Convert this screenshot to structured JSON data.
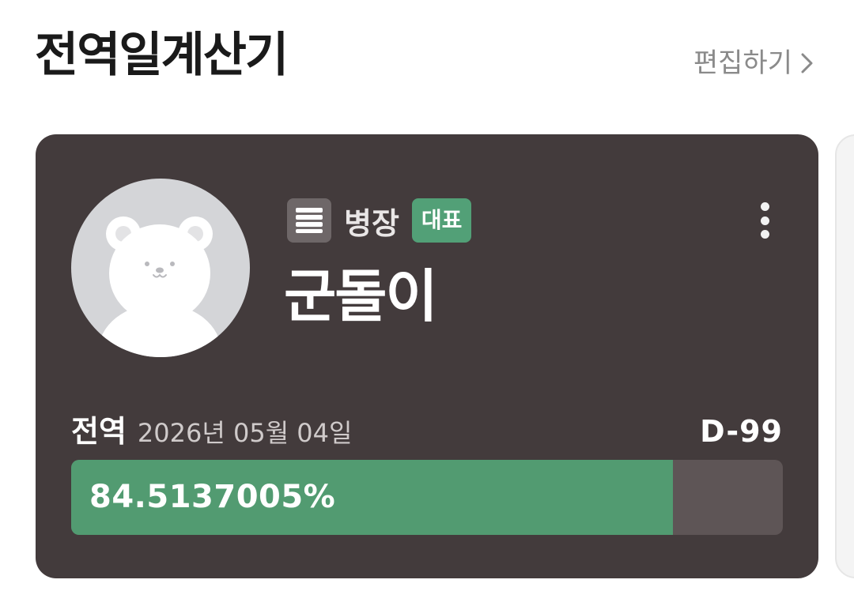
{
  "header": {
    "title": "전역일계산기",
    "edit_label": "편집하기"
  },
  "card": {
    "rank": "병장",
    "badge": "대표",
    "name": "군돌이",
    "discharge_label": "전역",
    "discharge_date": "2026년 05월 04일",
    "dday": "D-99",
    "progress_text": "84.5137005%",
    "progress_fraction": 0.845137005
  },
  "icons": {
    "rank": "sergeant-rank-icon",
    "menu": "more-vertical-icon",
    "chevron": "chevron-right-icon",
    "avatar": "bear-avatar"
  },
  "colors": {
    "card_bg": "#433b3c",
    "accent_green": "#529b71",
    "badge_green": "#52a077"
  }
}
